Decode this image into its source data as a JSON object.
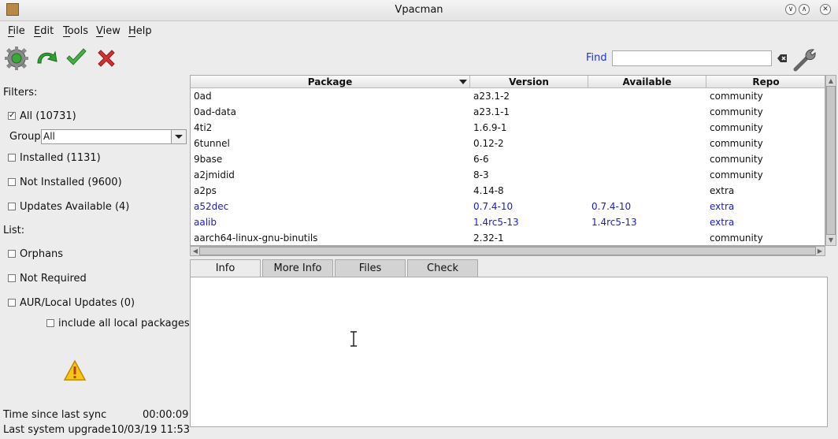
{
  "window": {
    "title": "Vpacman"
  },
  "menubar": {
    "items": [
      "File",
      "Edit",
      "Tools",
      "View",
      "Help"
    ]
  },
  "toolbar": {
    "icons": [
      "settings-gear-icon",
      "refresh-icon",
      "apply-checkmark-icon",
      "cancel-x-icon"
    ],
    "find_label": "Find",
    "find_value": "",
    "colors": {
      "find_label": "#2233cc",
      "apply": "#3aa63a",
      "cancel": "#d02020"
    }
  },
  "filters": {
    "heading": "Filters:",
    "all": {
      "label": "All (10731)",
      "checked": true
    },
    "group_label": "Group",
    "group_value": "All",
    "installed": {
      "label": "Installed (1131)",
      "checked": false
    },
    "not_installed": {
      "label": "Not Installed (9600)",
      "checked": false
    },
    "updates": {
      "label": "Updates Available (4)",
      "checked": false
    }
  },
  "list": {
    "heading": "List:",
    "orphans": {
      "label": "Orphans",
      "checked": false
    },
    "not_required": {
      "label": "Not Required",
      "checked": false
    },
    "aur": {
      "label": "AUR/Local Updates (0)",
      "checked": false
    },
    "include_local": {
      "label": "include all local packages",
      "checked": false
    }
  },
  "status": {
    "sync_label": "Time since last sync",
    "sync_value": "00:00:09",
    "upgrade_label": "Last system upgrade",
    "upgrade_value": "10/03/19 11:53"
  },
  "table": {
    "columns": [
      "Package",
      "Version",
      "Available",
      "Repo"
    ],
    "rows": [
      {
        "package": "0ad",
        "version": "a23.1-2",
        "available": "",
        "repo": "community",
        "update": false
      },
      {
        "package": "0ad-data",
        "version": "a23.1-1",
        "available": "",
        "repo": "community",
        "update": false
      },
      {
        "package": "4ti2",
        "version": "1.6.9-1",
        "available": "",
        "repo": "community",
        "update": false
      },
      {
        "package": "6tunnel",
        "version": "0.12-2",
        "available": "",
        "repo": "community",
        "update": false
      },
      {
        "package": "9base",
        "version": "6-6",
        "available": "",
        "repo": "community",
        "update": false
      },
      {
        "package": "a2jmidid",
        "version": "8-3",
        "available": "",
        "repo": "community",
        "update": false
      },
      {
        "package": "a2ps",
        "version": "4.14-8",
        "available": "",
        "repo": "extra",
        "update": false
      },
      {
        "package": "a52dec",
        "version": "0.7.4-10",
        "available": "0.7.4-10",
        "repo": "extra",
        "update": true
      },
      {
        "package": "aalib",
        "version": "1.4rc5-13",
        "available": "1.4rc5-13",
        "repo": "extra",
        "update": true
      },
      {
        "package": "aarch64-linux-gnu-binutils",
        "version": "2.32-1",
        "available": "",
        "repo": "community",
        "update": false
      }
    ]
  },
  "tabs": [
    "Info",
    "More Info",
    "Files",
    "Check"
  ],
  "active_tab": "Info"
}
